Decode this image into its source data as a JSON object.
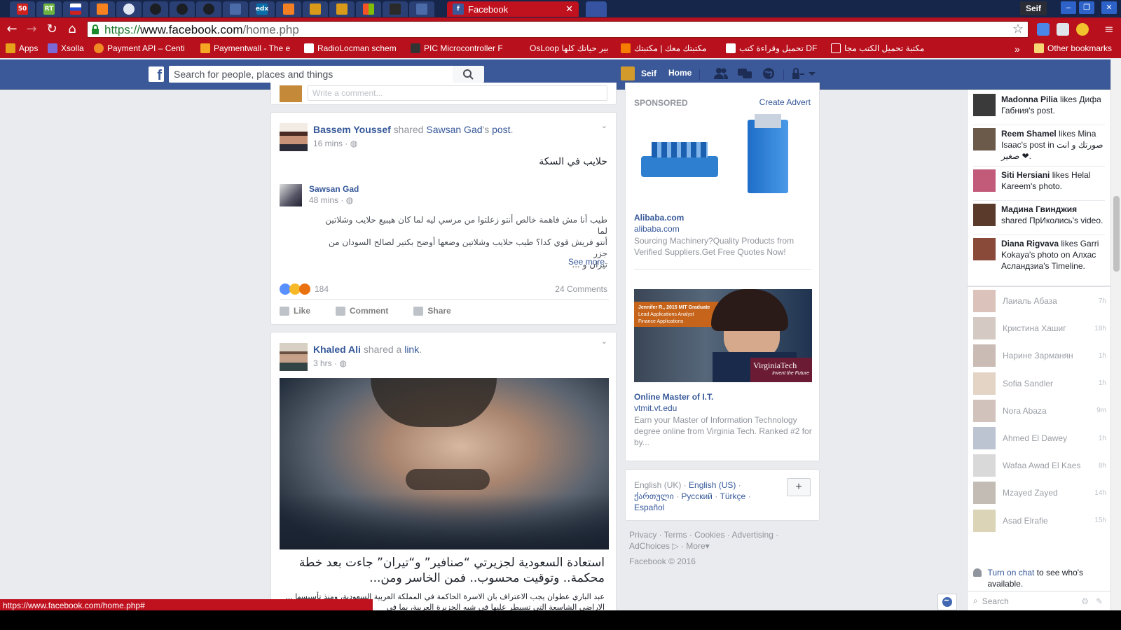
{
  "browser": {
    "tab_count_badge": "50",
    "active_tab_title": "Facebook",
    "url_scheme": "https://",
    "url_host": "www.facebook.com",
    "url_path": "/home.php",
    "user_name": "Seif",
    "status_url": "https://www.facebook.com/home.php#"
  },
  "bookmarks": [
    {
      "label": "Apps",
      "color": "#e6a11a"
    },
    {
      "label": "Xsolla",
      "color": "#7b6ad6"
    },
    {
      "label": "Payment API – Centi",
      "color": "#f08a24"
    },
    {
      "label": "Paymentwall - The e",
      "color": "#f5a623"
    },
    {
      "label": "RadioLocman schem",
      "color": "#ffffff"
    },
    {
      "label": "PIC Microcontroller F",
      "color": "#333333"
    },
    {
      "label": "OsLoop",
      "color": "#b8101c"
    },
    {
      "label": "بير حياتك كلها",
      "color": "#b8101c"
    },
    {
      "label": "مكتبتك معك | مكتبتك",
      "color": "#f57c00"
    },
    {
      "label": "تحميل وقراءة كتب DF",
      "color": "#ffffff"
    },
    {
      "label": "مكتبة تحميل الكتب مجا",
      "color": "#b8101c"
    },
    {
      "label": "Other bookmarks",
      "color": "#f7d774"
    }
  ],
  "fb": {
    "search_placeholder": "Search for people, places and things",
    "user": "Seif",
    "home": "Home"
  },
  "post1": {
    "author": "Bassem Youssef",
    "action": "shared",
    "shared_from": "Sawsan Gad",
    "shared_suffix": "'s",
    "post_word": "post",
    "time": "16 mins",
    "text": "حلايب في السكة",
    "inner_author": "Sawsan Gad",
    "inner_time": "48 mins",
    "inner_text_1": "طيب أنا مش فاهمة خالص أنتو زعلتوا من مرسي ليه لما كان هيبيع حلايب وشلاتين لما",
    "inner_text_2": "أنتو فريش قوي كدا؟ طيب حلايب وشلاتين وضعها أوضح بكتير لصالح السودان من جزر",
    "inner_text_3": "تيران و ...",
    "see_more": "See more",
    "reaction_count": "184",
    "comments": "24 Comments",
    "like": "Like",
    "comment": "Comment",
    "share": "Share",
    "comment_placeholder": "Write a comment..."
  },
  "post2": {
    "author": "Khaled Ali",
    "action": "shared a",
    "link_word": "link",
    "time": "3 hrs",
    "headline": "استعادة السعودية لجزيرتي “صنافير” و“تيران” جاءت بعد خطة محكمة.. وتوقيت محسوب.. فمن الخاسر ومن...",
    "snippet": "عبد الباري عطوان يجب الاعتراف بان الاسرة الحاكمة في المملكة العربية السعودية، ومنذ تأسيسها ... الاراضي الشاسعة التي تسيطر عليها في شبه الجزيرة العربية، بما في"
  },
  "sponsored": {
    "header": "SPONSORED",
    "create_advert": "Create Advert",
    "ad1_title": "Alibaba.com",
    "ad1_domain": "alibaba.com",
    "ad1_text": "Sourcing Machinery?Quality Products from Verified Suppliers.Get Free Quotes Now!",
    "ad2_banner_1": "Jennifer R., 2015 MIT Graduate",
    "ad2_banner_2": "Lead Applications Analyst",
    "ad2_banner_3": "Finance Applications",
    "ad2_brand": "VirginiaTech",
    "ad2_tagline": "Invent the Future",
    "ad2_title": "Online Master of I.T.",
    "ad2_domain": "vtmit.vt.edu",
    "ad2_text": "Earn your Master of Information Technology degree online from Virginia Tech. Ranked #2 for by..."
  },
  "languages": {
    "current": "English (UK)",
    "options": [
      "English (US)",
      "ქართული",
      "Русский",
      "Türkçe",
      "Español"
    ],
    "add": "+"
  },
  "footer": {
    "links": [
      "Privacy",
      "Terms",
      "Cookies",
      "Advertising",
      "AdChoices",
      "More"
    ],
    "copyright": "Facebook © 2016"
  },
  "ticker": [
    {
      "name": "Madonna Pilia",
      "text": " likes Дифа Габния's post.",
      "color": "#3a3a3a"
    },
    {
      "name": "Reem Shamel",
      "text": " likes Mina Isaac's post in صورتك و انت صغير ❤.",
      "color": "#6b5a4a"
    },
    {
      "name": "Siti Hersiani",
      "text": " likes Helal Kareem's photo.",
      "color": "#c25a7a"
    },
    {
      "name": "Мадина Гвинджия",
      "text": " shared ПрИколись's video.",
      "color": "#5a3a2a"
    },
    {
      "name": "Diana Rigvava",
      "text": " likes Garri Kokaya's photo on Алхас Асландзиа's Timeline.",
      "color": "#8a4a3a"
    }
  ],
  "contacts": [
    {
      "name": "Лаиаль Абаза",
      "time": "7h",
      "color": "#b07a6a"
    },
    {
      "name": "Кристина Хашиг",
      "time": "18h",
      "color": "#a08a7a"
    },
    {
      "name": "Нарине Зарманян",
      "time": "1h",
      "color": "#8a6a5a"
    },
    {
      "name": "Sofia Sandler",
      "time": "1h",
      "color": "#c0a080"
    },
    {
      "name": "Nora Abaza",
      "time": "9m",
      "color": "#9a7a6a"
    },
    {
      "name": "Ahmed El Dawey",
      "time": "1h",
      "color": "#6a7a9a"
    },
    {
      "name": "Wafaa Awad El Kaes",
      "time": "8h",
      "color": "#aaaaaa"
    },
    {
      "name": "Mzayed Zayed",
      "time": "14h",
      "color": "#7a6a5a"
    },
    {
      "name": "Asad Elrafie",
      "time": "15h",
      "color": "#b0a060"
    }
  ],
  "chat": {
    "turn_on": "Turn on chat",
    "turn_on_suffix": " to see who's available.",
    "search": "Search"
  }
}
